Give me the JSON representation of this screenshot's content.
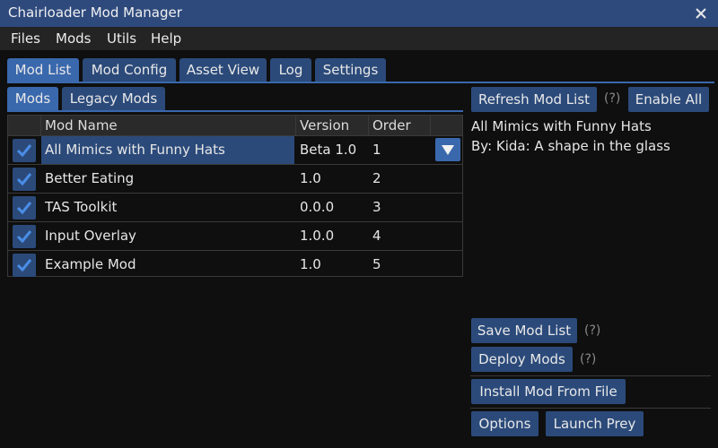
{
  "window": {
    "title": "Chairloader Mod Manager"
  },
  "menu": [
    "Files",
    "Mods",
    "Utils",
    "Help"
  ],
  "main_tabs": [
    {
      "label": "Mod List",
      "active": true
    },
    {
      "label": "Mod Config",
      "active": false
    },
    {
      "label": "Asset View",
      "active": false
    },
    {
      "label": "Log",
      "active": false
    },
    {
      "label": "Settings",
      "active": false
    }
  ],
  "sub_tabs": [
    {
      "label": "Mods",
      "active": true
    },
    {
      "label": "Legacy Mods",
      "active": false
    }
  ],
  "table": {
    "headers": {
      "name": "Mod Name",
      "version": "Version",
      "order": "Order"
    },
    "rows": [
      {
        "name": "All Mimics with Funny Hats",
        "version": "Beta 1.0",
        "order": "1",
        "enabled": true,
        "selected": true
      },
      {
        "name": "Better Eating",
        "version": "1.0",
        "order": "2",
        "enabled": true,
        "selected": false
      },
      {
        "name": "TAS Toolkit",
        "version": "0.0.0",
        "order": "3",
        "enabled": true,
        "selected": false
      },
      {
        "name": "Input Overlay",
        "version": "1.0.0",
        "order": "4",
        "enabled": true,
        "selected": false
      },
      {
        "name": "Example Mod",
        "version": "1.0",
        "order": "5",
        "enabled": true,
        "selected": false
      }
    ]
  },
  "right_panel": {
    "refresh_label": "Refresh Mod List",
    "help": "(?)",
    "enable_all_label": "Enable All",
    "selected_mod_name": "All Mimics with Funny Hats",
    "selected_mod_author": "By: Kida: A shape in the glass",
    "save_label": "Save Mod List",
    "deploy_label": "Deploy Mods",
    "install_label": "Install Mod From File",
    "options_label": "Options",
    "launch_label": "Launch Prey"
  },
  "colors": {
    "accent": "#3a68ad",
    "button": "#2b4a7a",
    "titlebar": "#2e4a7d",
    "background": "#0f0f0f"
  },
  "icons": {
    "close": "close-icon",
    "checkbox": "checkmark-icon",
    "dropdown": "triangle-down-icon"
  }
}
